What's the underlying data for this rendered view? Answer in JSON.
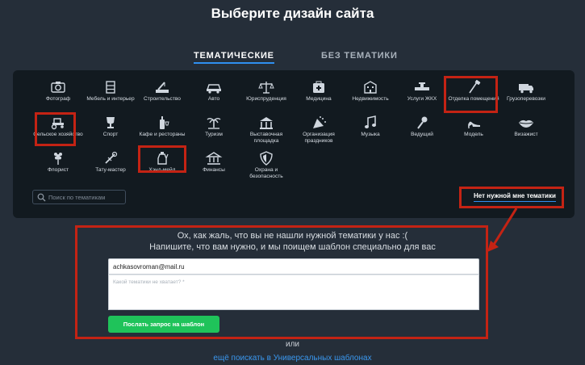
{
  "header": {
    "title": "Выберите дизайн сайта"
  },
  "tabs": [
    {
      "label": "ТЕМАТИЧЕСКИЕ",
      "active": true
    },
    {
      "label": "БЕЗ ТЕМАТИКИ",
      "active": false
    }
  ],
  "categories": [
    {
      "label": "Фотограф",
      "icon": "camera-icon"
    },
    {
      "label": "Мебель и интерьер",
      "icon": "furniture-icon"
    },
    {
      "label": "Строительство",
      "icon": "crane-icon"
    },
    {
      "label": "Авто",
      "icon": "car-icon"
    },
    {
      "label": "Юриспруденция",
      "icon": "scales-icon"
    },
    {
      "label": "Медицина",
      "icon": "medical-kit-icon"
    },
    {
      "label": "Недвижимость",
      "icon": "building-icon"
    },
    {
      "label": "Услуги ЖКХ",
      "icon": "pipe-icon"
    },
    {
      "label": "Отделка помещений",
      "icon": "paint-roller-icon"
    },
    {
      "label": "Грузоперевозки",
      "icon": "truck-icon"
    },
    {
      "label": "Сельское хозяйство",
      "icon": "tractor-icon"
    },
    {
      "label": "Спорт",
      "icon": "trophy-icon"
    },
    {
      "label": "Кафе и рестораны",
      "icon": "bottle-icon"
    },
    {
      "label": "Туризм",
      "icon": "palm-icon"
    },
    {
      "label": "Выставочная площадка",
      "icon": "exhibition-icon"
    },
    {
      "label": "Организация праздников",
      "icon": "party-icon"
    },
    {
      "label": "Музыка",
      "icon": "music-note-icon"
    },
    {
      "label": "Ведущий",
      "icon": "microphone-icon"
    },
    {
      "label": "Модель",
      "icon": "high-heel-icon"
    },
    {
      "label": "Визажист",
      "icon": "lips-icon"
    },
    {
      "label": "Флорист",
      "icon": "flower-icon"
    },
    {
      "label": "Тату-мастер",
      "icon": "tattoo-machine-icon"
    },
    {
      "label": "Хэнд-мейд",
      "icon": "handmade-jar-icon"
    },
    {
      "label": "Финансы",
      "icon": "bank-icon"
    },
    {
      "label": "Охрана и безопасность",
      "icon": "shield-icon"
    }
  ],
  "search": {
    "placeholder": "Поиск по тематикам"
  },
  "no_match_link": "Нет нужной мне тематики",
  "request": {
    "line1": "Ох, как жаль, что вы не нашли нужной тематики у нас :(",
    "line2": "Напишите, что вам нужно, и мы поищем шаблон специально для вас",
    "email_value": "achkasovroman@mail.ru",
    "textarea_placeholder": "Какой тематики не хватает? *",
    "submit_label": "Послать запрос на шаблон"
  },
  "or_text": "или",
  "more_link": "ещё поискать в Универсальных шаблонах",
  "colors": {
    "accent": "#2f8ff0",
    "highlight": "#c42314",
    "button": "#1fc35a"
  }
}
